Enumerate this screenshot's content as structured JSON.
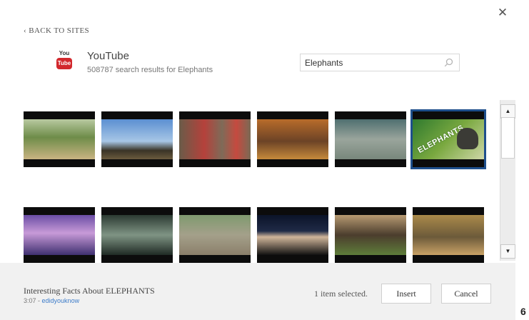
{
  "dialog": {
    "close_glyph": "✕",
    "back_label": "‹ BACK TO SITES"
  },
  "provider": {
    "logo_top": "You",
    "logo_bottom": "Tube",
    "name": "YouTube",
    "results_text": "508787 search results for Elephants"
  },
  "search": {
    "value": "Elephants",
    "icon": "search-icon"
  },
  "results": {
    "selected_index": 5,
    "thumbnails": [
      {
        "name": "thumb-elephant-herd-grass",
        "gradient": "linear-gradient(180deg,#b8c9a0 0%,#6e8c49 45%,#c9b482 100%)",
        "badge": ""
      },
      {
        "name": "thumb-elephants-horizon",
        "gradient": "linear-gradient(180deg,#5b8fd1 0%,#a7c6e6 55%,#3a3426 78%,#6b5b3e 100%)",
        "badge": ""
      },
      {
        "name": "thumb-red-blanket-elephants",
        "gradient": "linear-gradient(90deg,#6a5c49 0%,#b5413b 35%,#7e6b58 60%,#c54a3f 80%,#7a6a55 100%)",
        "badge": ""
      },
      {
        "name": "thumb-elephant-golden",
        "gradient": "linear-gradient(180deg,#b86c2a 0%,#6c4326 55%,#c68a3b 100%)",
        "badge": ""
      },
      {
        "name": "thumb-elephants-resting",
        "gradient": "linear-gradient(180deg,#4f6f70 0%,#9aa59c 50%,#78877c 100%)",
        "badge": ""
      },
      {
        "name": "thumb-elephants-title-card",
        "gradient": "linear-gradient(135deg,#2f7a2f 0%,#79a83f 50%,#cfd7a8 100%)",
        "badge": "ELEPHANTS"
      },
      {
        "name": "thumb-purple-flowers",
        "gradient": "linear-gradient(180deg,#6a4ea5 0%,#c89ad8 45%,#3f3070 100%)",
        "badge": ""
      },
      {
        "name": "thumb-corridor-stalls",
        "gradient": "linear-gradient(180deg,#2c3a32 0%,#7f9484 50%,#1f2a24 100%)",
        "badge": ""
      },
      {
        "name": "thumb-elephant-trainer",
        "gradient": "linear-gradient(180deg,#7f9a6f 0%,#a4a08a 50%,#8b7f6a 100%)",
        "badge": ""
      },
      {
        "name": "thumb-presenter-dark",
        "gradient": "linear-gradient(180deg,#0b1328 0%,#1f2a46 40%,#d0b59a 55%,#111 100%)",
        "badge": ""
      },
      {
        "name": "thumb-elephant-family",
        "gradient": "linear-gradient(180deg,#b79a72 0%,#4b3d2d 50%,#5e7d3a 100%)",
        "badge": ""
      },
      {
        "name": "thumb-elephants-savanna",
        "gradient": "linear-gradient(180deg,#aa8a4a 0%,#6c5a3a 55%,#c9a266 100%)",
        "badge": ""
      }
    ]
  },
  "footer": {
    "video_title": "Interesting Facts About ELEPHANTS",
    "video_duration": "3:07",
    "video_sep": " - ",
    "video_channel": "edidyouknow",
    "selected_text": "1 item selected.",
    "insert_label": "Insert",
    "cancel_label": "Cancel"
  },
  "edge": {
    "digit": "6"
  }
}
